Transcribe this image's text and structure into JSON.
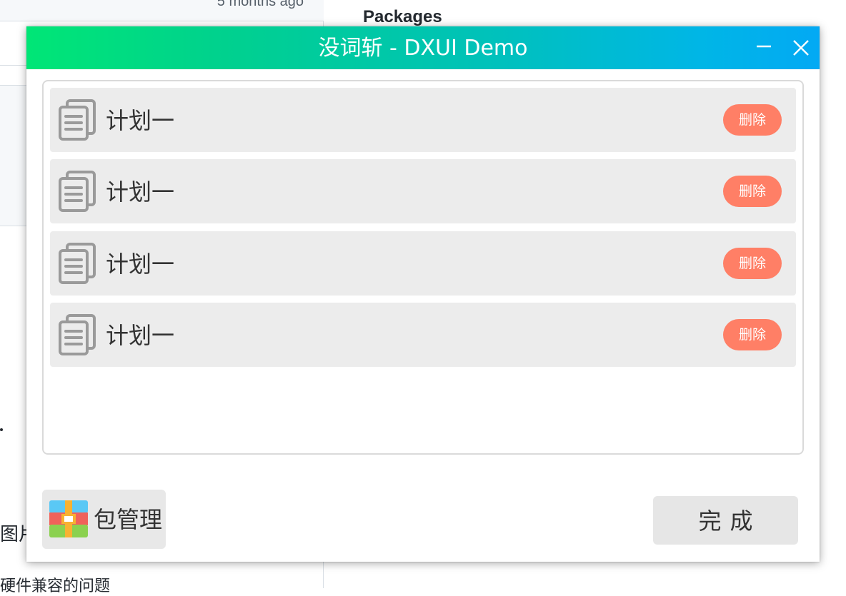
{
  "background": {
    "timestamp": "5 months ago",
    "packages_heading": "Packages",
    "text_fragment_1": "图片",
    "text_fragment_2": "硬件兼容的问题"
  },
  "window": {
    "title": "没词斩 - DXUI Demo",
    "minimize_icon": "minimize-icon",
    "close_icon": "close-icon"
  },
  "plans": [
    {
      "label": "计划一",
      "delete_label": "删除",
      "icon": "document-copy-icon"
    },
    {
      "label": "计划一",
      "delete_label": "删除",
      "icon": "document-copy-icon"
    },
    {
      "label": "计划一",
      "delete_label": "删除",
      "icon": "document-copy-icon"
    },
    {
      "label": "计划一",
      "delete_label": "删除",
      "icon": "document-copy-icon"
    }
  ],
  "footer": {
    "package_button_label": "包管理",
    "package_icon": "package-icon",
    "done_button_label": "完成"
  },
  "colors": {
    "title_gradient_start": "#00e676",
    "title_gradient_end": "#03a9f4",
    "delete_button": "#ff7f66",
    "item_background": "#ececec"
  }
}
